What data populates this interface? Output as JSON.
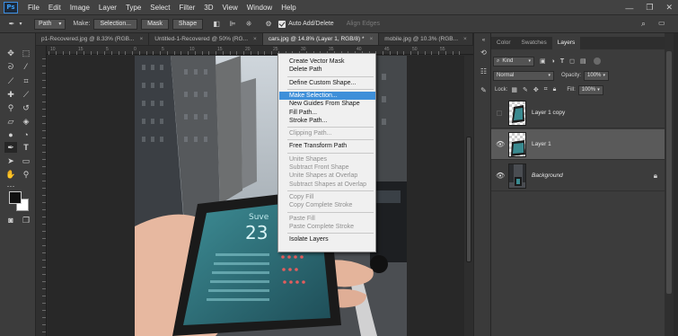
{
  "app": {
    "logo": "Ps"
  },
  "menubar": [
    "File",
    "Edit",
    "Image",
    "Layer",
    "Type",
    "Select",
    "Filter",
    "3D",
    "View",
    "Window",
    "Help"
  ],
  "window_controls": [
    "—",
    "❐",
    "✕"
  ],
  "options": {
    "mode_select": "Path",
    "make_label": "Make:",
    "selection_btn": "Selection...",
    "mask_btn": "Mask",
    "shape_btn": "Shape",
    "auto_add_delete": "Auto Add/Delete",
    "auto_add_checked": true,
    "align_edges": "Align Edges"
  },
  "doc_tabs": [
    {
      "label": "p1-Recovered.jpg @ 8.33% (RGB...",
      "active": false
    },
    {
      "label": "Untitled-1-Recovered @ 50% (RG...",
      "active": false
    },
    {
      "label": "cars.jpg @ 14.8% (Layer 1, RGB/8) *",
      "active": true
    },
    {
      "label": "mobile.jpg @ 10.3% (RGB...",
      "active": false
    }
  ],
  "ruler_top_numbers": [
    "10",
    "15",
    "5",
    "0",
    "5",
    "10",
    "15",
    "20",
    "25",
    "30",
    "35",
    "40",
    "45",
    "50",
    "55"
  ],
  "context_menu": {
    "items": [
      {
        "label": "Create Vector Mask",
        "disabled": false
      },
      {
        "label": "Delete Path",
        "disabled": false
      },
      {
        "sep": true
      },
      {
        "label": "Define Custom Shape...",
        "disabled": false
      },
      {
        "sep": true
      },
      {
        "label": "Make Selection...",
        "disabled": false,
        "highlight": true
      },
      {
        "label": "New Guides From Shape",
        "disabled": false
      },
      {
        "label": "Fill Path...",
        "disabled": false
      },
      {
        "label": "Stroke Path...",
        "disabled": false
      },
      {
        "sep": true
      },
      {
        "label": "Clipping Path...",
        "disabled": true
      },
      {
        "sep": true
      },
      {
        "label": "Free Transform Path",
        "disabled": false
      },
      {
        "sep": true
      },
      {
        "label": "Unite Shapes",
        "disabled": true
      },
      {
        "label": "Subtract Front Shape",
        "disabled": true
      },
      {
        "label": "Unite Shapes at Overlap",
        "disabled": true
      },
      {
        "label": "Subtract Shapes at Overlap",
        "disabled": true
      },
      {
        "sep": true
      },
      {
        "label": "Copy Fill",
        "disabled": true
      },
      {
        "label": "Copy Complete Stroke",
        "disabled": true
      },
      {
        "sep": true
      },
      {
        "label": "Paste Fill",
        "disabled": true
      },
      {
        "label": "Paste Complete Stroke",
        "disabled": true
      },
      {
        "sep": true
      },
      {
        "label": "Isolate Layers",
        "disabled": false
      }
    ]
  },
  "phone_screen": {
    "title": "Suve",
    "big_number": "23"
  },
  "panel": {
    "tabs": [
      "Color",
      "Swatches",
      "Layers"
    ],
    "active_tab": "Layers",
    "kind_label": "Kind",
    "blend_mode": "Normal",
    "opacity_label": "Opacity:",
    "opacity_value": "100%",
    "lock_label": "Lock:",
    "fill_label": "Fill:",
    "fill_value": "100%",
    "layers": [
      {
        "name": "Layer 1 copy",
        "visible": false,
        "selected": false,
        "italic": false,
        "locked": false
      },
      {
        "name": "Layer 1",
        "visible": true,
        "selected": true,
        "italic": false,
        "locked": false
      },
      {
        "name": "Background",
        "visible": true,
        "selected": false,
        "italic": true,
        "locked": true
      }
    ]
  }
}
